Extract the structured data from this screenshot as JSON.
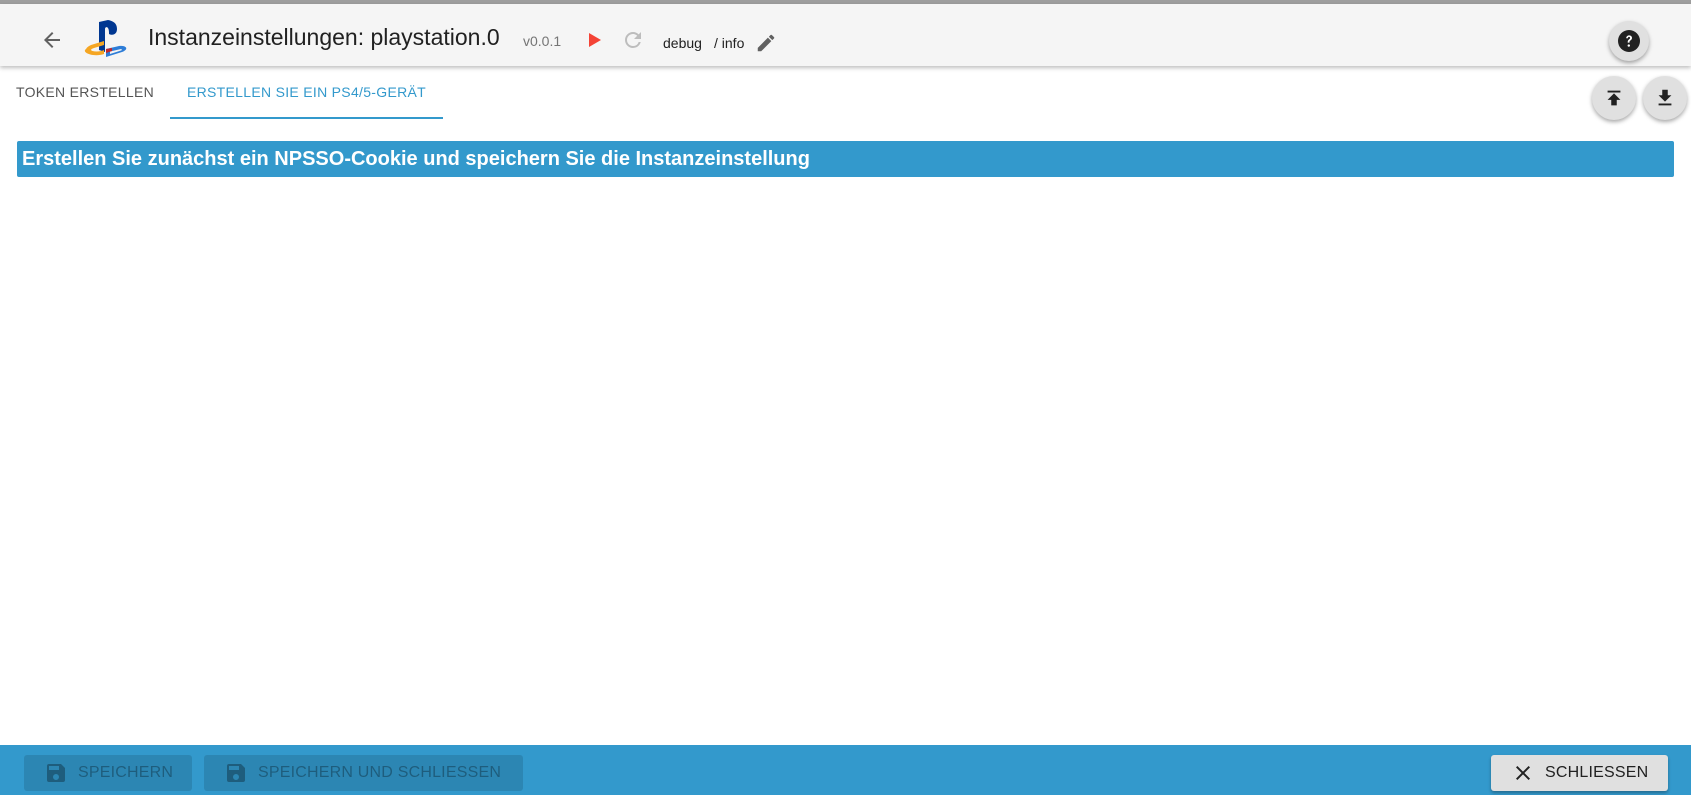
{
  "header": {
    "title": "Instanzeinstellungen: playstation.0",
    "version": "v0.0.1",
    "log_level": "debug",
    "log_separator": "/ info",
    "icons": {
      "back": "arrow-left-icon",
      "logo": "playstation-logo",
      "start": "play-icon",
      "restart": "reload-icon",
      "edit": "pencil-icon",
      "help": "help-circle-icon"
    }
  },
  "tabs": [
    {
      "label": "TOKEN ERSTELLEN",
      "active": false
    },
    {
      "label": "ERSTELLEN SIE EIN PS4/5-GERÄT",
      "active": true
    }
  ],
  "tab_actions": {
    "icons": [
      "upload-icon",
      "download-icon"
    ]
  },
  "main": {
    "info_header": "Erstellen Sie zunächst ein NPSSO-Cookie und speichern Sie die Instanzeinstellung"
  },
  "footer": {
    "save_label": "SPEICHERN",
    "save_close_label": "SPEICHERN UND SCHLIESSEN",
    "close_label": "SCHLIESSEN",
    "save_enabled": false,
    "save_close_enabled": false
  },
  "colors": {
    "accent": "#3399cc",
    "play": "#f44336",
    "topbar": "#f5f5f5"
  }
}
